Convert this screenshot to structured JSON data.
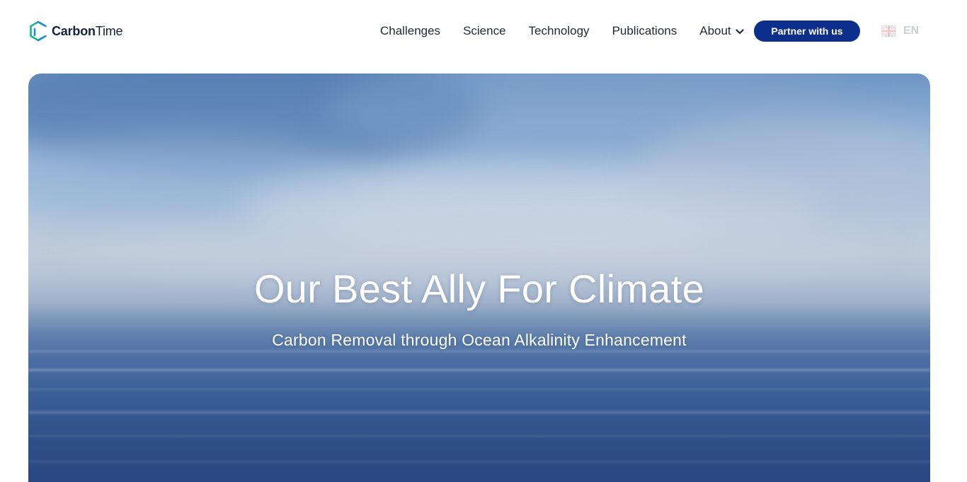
{
  "brand": {
    "name_bold": "Carbon",
    "name_regular": "Time",
    "logo_icon": "hexagon-c-logo-icon",
    "logo_colors": [
      "#1bb38b",
      "#1f8fd6"
    ]
  },
  "nav": {
    "items": [
      {
        "label": "Challenges"
      },
      {
        "label": "Science"
      },
      {
        "label": "Technology"
      },
      {
        "label": "Publications"
      }
    ],
    "about": {
      "label": "About",
      "icon": "chevron-down-icon"
    },
    "cta_label": "Partner with us",
    "language": {
      "code": "EN",
      "icon": "uk-flag-icon"
    }
  },
  "hero": {
    "title": "Our Best Ally For Climate",
    "subtitle": "Carbon Removal through Ocean Alkalinity Enhancement"
  },
  "colors": {
    "accent": "#0c2f8c",
    "text": "#1f2a37"
  }
}
